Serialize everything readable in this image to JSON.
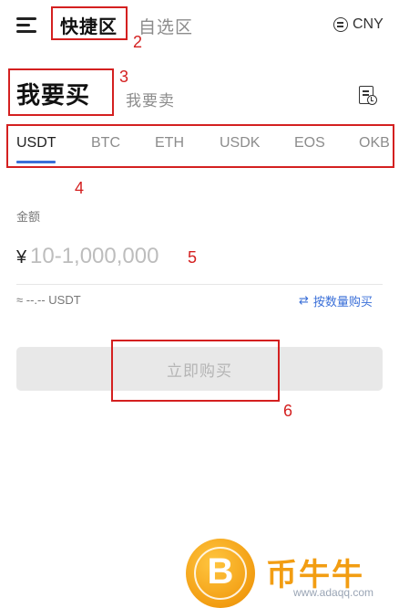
{
  "header": {
    "quick_tab": "快捷区",
    "self_tab": "自选区",
    "currency": "CNY"
  },
  "trade": {
    "buy_tab": "我要买",
    "sell_tab": "我要卖"
  },
  "coins": [
    "USDT",
    "BTC",
    "ETH",
    "USDK",
    "EOS",
    "OKB"
  ],
  "form": {
    "amount_label": "金额",
    "currency_symbol": "¥",
    "amount_placeholder": "10-1,000,000",
    "approx_text": "≈ --.-- USDT",
    "by_quantity_label": "按数量购买",
    "submit_label": "立即购买"
  },
  "annotations": [
    "2",
    "3",
    "4",
    "5",
    "6"
  ],
  "watermark": {
    "brand": "币牛牛",
    "site": "www.adaqq.com",
    "coin_symbol": "B"
  },
  "colors": {
    "accent": "#3a6fd8",
    "annotation": "#d42020",
    "brand": "#f29d12",
    "disabled_button": "#e8e8e8"
  }
}
